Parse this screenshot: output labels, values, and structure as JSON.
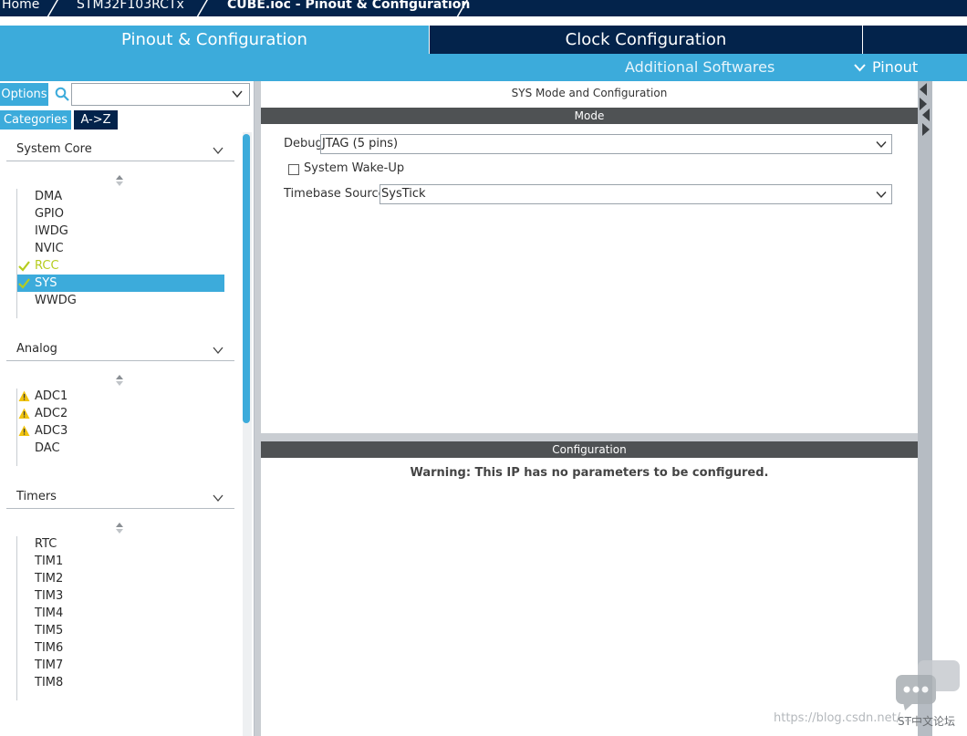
{
  "breadcrumb": {
    "items": [
      "Home",
      "STM32F103RCTx",
      "CUBE.ioc - Pinout & Configuration"
    ]
  },
  "tabs": {
    "pinout": "Pinout & Configuration",
    "clock": "Clock Configuration"
  },
  "subbar": {
    "additional": "Additional Softwares",
    "pinout": "Pinout"
  },
  "left_panel": {
    "options_label": "Options",
    "search": {
      "value": "",
      "placeholder": ""
    },
    "tab_categories": "Categories",
    "tab_az": "A->Z",
    "categories": [
      {
        "title": "System Core",
        "items": [
          {
            "label": "DMA",
            "status": "none"
          },
          {
            "label": "GPIO",
            "status": "none"
          },
          {
            "label": "IWDG",
            "status": "none"
          },
          {
            "label": "NVIC",
            "status": "none"
          },
          {
            "label": "RCC",
            "status": "ok"
          },
          {
            "label": "SYS",
            "status": "ok",
            "selected": true
          },
          {
            "label": "WWDG",
            "status": "none"
          }
        ]
      },
      {
        "title": "Analog",
        "items": [
          {
            "label": "ADC1",
            "status": "warning"
          },
          {
            "label": "ADC2",
            "status": "warning"
          },
          {
            "label": "ADC3",
            "status": "warning"
          },
          {
            "label": "DAC",
            "status": "none"
          }
        ]
      },
      {
        "title": "Timers",
        "items": [
          {
            "label": "RTC",
            "status": "none"
          },
          {
            "label": "TIM1",
            "status": "none"
          },
          {
            "label": "TIM2",
            "status": "none"
          },
          {
            "label": "TIM3",
            "status": "none"
          },
          {
            "label": "TIM4",
            "status": "none"
          },
          {
            "label": "TIM5",
            "status": "none"
          },
          {
            "label": "TIM6",
            "status": "none"
          },
          {
            "label": "TIM7",
            "status": "none"
          },
          {
            "label": "TIM8",
            "status": "none"
          }
        ]
      }
    ]
  },
  "mode_panel": {
    "title": "SYS Mode and Configuration",
    "mode_header": "Mode",
    "debug_label": "Debug",
    "debug_value": "JTAG (5 pins)",
    "wakeup_label": "System Wake-Up",
    "wakeup_checked": false,
    "timebase_label": "Timebase Source",
    "timebase_value": "SysTick"
  },
  "config_panel": {
    "header": "Configuration",
    "warning": "Warning: This IP has no parameters to be configured."
  },
  "watermark": {
    "url": "https://blog.csdn.net/...",
    "site": "ST中文论坛"
  },
  "colors": {
    "navy": "#03234b",
    "accent": "#3cabdb",
    "ok": "#b6cc1e",
    "warning": "#f1c40f",
    "band": "#4f5254"
  }
}
